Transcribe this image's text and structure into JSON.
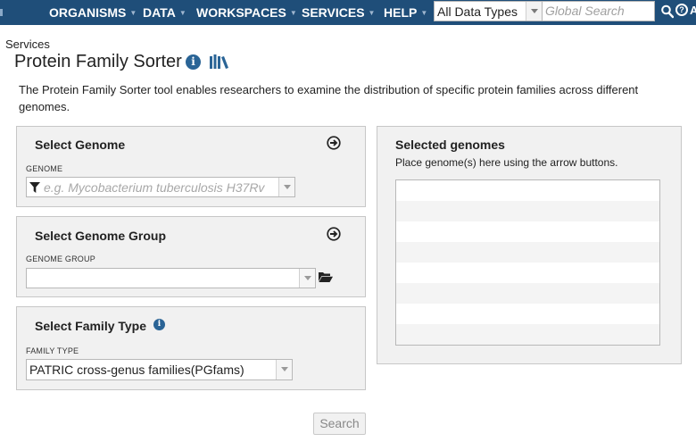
{
  "nav": {
    "items": [
      "ORGANISMS",
      "DATA",
      "WORKSPACES",
      "SERVICES",
      "HELP"
    ],
    "data_type_value": "All Data Types",
    "search_placeholder": "Global Search",
    "search_icon": "search-icon",
    "help_icon": "question-circle-icon",
    "cut_text": "A"
  },
  "page": {
    "breadcrumb": "Services",
    "title": "Protein Family Sorter",
    "description": "The Protein Family Sorter tool enables researchers to examine the distribution of specific protein families across different genomes."
  },
  "select_genome": {
    "title": "Select Genome",
    "field_label": "GENOME",
    "placeholder": "e.g. Mycobacterium tuberculosis H37Rv"
  },
  "select_genome_group": {
    "title": "Select Genome Group",
    "field_label": "GENOME GROUP",
    "value": ""
  },
  "select_family_type": {
    "title": "Select Family Type",
    "field_label": "FAMILY TYPE",
    "value": "PATRIC cross-genus families(PGfams)"
  },
  "selected_genomes": {
    "title": "Selected genomes",
    "hint": "Place genome(s) here using the arrow buttons.",
    "rows": 8
  },
  "actions": {
    "search_label": "Search"
  },
  "colors": {
    "nav_bg": "#1f4e79",
    "accent": "#2a6496",
    "panel_bg": "#f1f1f1"
  }
}
